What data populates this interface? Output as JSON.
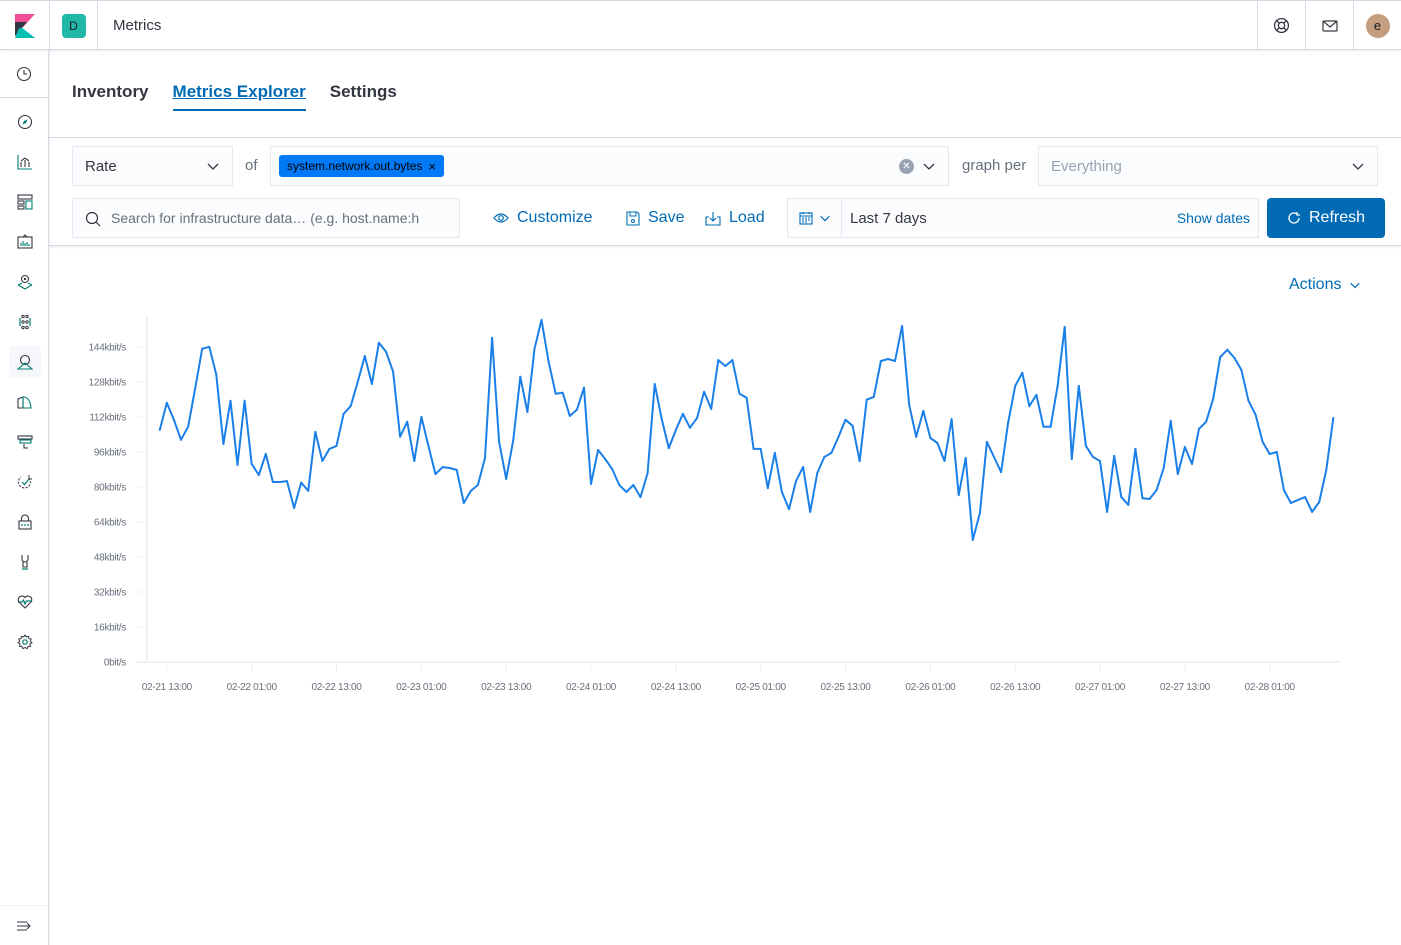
{
  "header": {
    "space_initial": "D",
    "app_title": "Metrics",
    "user_initial": "e",
    "icons": [
      "help-icon",
      "newsfeed-mail-icon"
    ]
  },
  "sidenav": {
    "items": [
      {
        "name": "recently-viewed",
        "icon": "clock-icon"
      },
      {
        "name": "discover",
        "icon": "compass-icon"
      },
      {
        "name": "visualize",
        "icon": "visualize-icon"
      },
      {
        "name": "dashboard",
        "icon": "dashboard-icon"
      },
      {
        "name": "canvas",
        "icon": "canvas-icon"
      },
      {
        "name": "maps",
        "icon": "maps-icon"
      },
      {
        "name": "ml",
        "icon": "machine-learning-icon"
      },
      {
        "name": "metrics",
        "icon": "metrics-app-icon",
        "active": true
      },
      {
        "name": "logs",
        "icon": "logs-icon"
      },
      {
        "name": "apm",
        "icon": "apm-icon"
      },
      {
        "name": "uptime",
        "icon": "uptime-icon"
      },
      {
        "name": "siem",
        "icon": "siem-icon"
      },
      {
        "name": "dev-tools",
        "icon": "dev-tools-icon"
      },
      {
        "name": "monitoring",
        "icon": "monitoring-icon"
      },
      {
        "name": "management",
        "icon": "gear-icon"
      }
    ],
    "collapse_icon": "menu-collapse-icon"
  },
  "tabs": [
    {
      "label": "Inventory",
      "selected": false
    },
    {
      "label": "Metrics Explorer",
      "selected": true
    },
    {
      "label": "Settings",
      "selected": false
    }
  ],
  "toolbar": {
    "aggregation": "Rate",
    "of_label": "of",
    "metric_pill": "system.network.out.bytes",
    "graph_per_label": "graph per",
    "group_by_placeholder": "Everything",
    "search_placeholder": "Search for infrastructure data… (e.g. host.name:h",
    "customize_label": "Customize",
    "save_label": "Save",
    "load_label": "Load",
    "date_range": "Last 7 days",
    "show_dates_label": "Show dates",
    "refresh_label": "Refresh"
  },
  "actions_label": "Actions",
  "colors": {
    "accent": "#006bb4",
    "line": "#1a7fe8",
    "pill": "#0079f6"
  },
  "chart_data": {
    "type": "line",
    "title": "",
    "xlabel": "",
    "ylabel": "",
    "series": [
      {
        "name": "system.network.out.bytes",
        "unit": "kbit/s"
      }
    ],
    "ylim": [
      0,
      152
    ],
    "y_ticks": [
      0,
      16,
      32,
      48,
      64,
      80,
      96,
      112,
      128,
      144
    ],
    "y_tick_labels": [
      "0bit/s",
      "16kbit/s",
      "32kbit/s",
      "48kbit/s",
      "64kbit/s",
      "80kbit/s",
      "96kbit/s",
      "112kbit/s",
      "128kbit/s",
      "144kbit/s"
    ],
    "x_tick_labels": [
      "02-21 13:00",
      "02-22 01:00",
      "02-22 13:00",
      "02-23 01:00",
      "02-23 13:00",
      "02-24 01:00",
      "02-24 13:00",
      "02-25 01:00",
      "02-25 13:00",
      "02-26 01:00",
      "02-26 13:00",
      "02-27 01:00",
      "02-27 13:00",
      "02-28 01:00"
    ],
    "x_start": "02-21 12:00",
    "x_step_hours": 1,
    "x_domain_hours": [
      -1.1,
      166.8
    ],
    "grid": false,
    "legend": "none",
    "values": [
      106.1,
      118.5,
      110.7,
      101.6,
      107.5,
      124.9,
      143.2,
      144.1,
      131.3,
      99.7,
      119.4,
      90.1,
      119.4,
      90.5,
      85.5,
      95.1,
      82.3,
      82.3,
      82.7,
      70.4,
      82.0,
      78.2,
      105.2,
      91.9,
      97.4,
      98.8,
      113.4,
      117.0,
      128.0,
      139.9,
      127.1,
      145.9,
      141.9,
      132.7,
      103.0,
      109.8,
      91.9,
      112.0,
      98.8,
      85.9,
      89.1,
      88.7,
      87.8,
      72.7,
      78.2,
      80.9,
      93.3,
      148.2,
      100.6,
      83.7,
      101.6,
      130.4,
      114.3,
      143.2,
      156.4,
      137.3,
      122.6,
      123.1,
      112.5,
      115.3,
      125.4,
      81.4,
      96.9,
      92.8,
      88.2,
      80.9,
      77.7,
      80.9,
      75.4,
      86.4,
      127.1,
      111.1,
      97.8,
      106.1,
      113.4,
      107.1,
      111.6,
      123.5,
      115.7,
      138.0,
      135.3,
      138.0,
      122.6,
      120.8,
      97.4,
      97.4,
      79.5,
      95.6,
      77.7,
      69.9,
      82.7,
      89.1,
      68.6,
      86.4,
      93.7,
      95.6,
      102.9,
      110.7,
      108.0,
      91.9,
      119.9,
      121.2,
      137.6,
      138.5,
      137.6,
      153.6,
      117.5,
      102.9,
      114.8,
      102.4,
      100.1,
      91.9,
      111.1,
      76.3,
      93.3,
      55.8,
      68.1,
      100.6,
      93.7,
      86.8,
      109.3,
      126.2,
      132.2,
      117.0,
      122.1,
      107.5,
      107.5,
      126.2,
      153.2,
      92.8,
      126.2,
      98.8,
      93.7,
      91.9,
      68.6,
      94.2,
      75.4,
      71.8,
      97.4,
      74.9,
      74.5,
      78.6,
      88.7,
      110.2,
      85.9,
      98.3,
      90.5,
      106.6,
      109.8,
      120.3,
      139.4,
      142.7,
      139.0,
      133.5,
      119.4,
      113.0,
      100.6,
      95.1,
      96.0,
      78.6,
      72.7,
      74.1,
      75.4,
      68.6,
      73.1,
      87.8,
      111.6
    ]
  }
}
